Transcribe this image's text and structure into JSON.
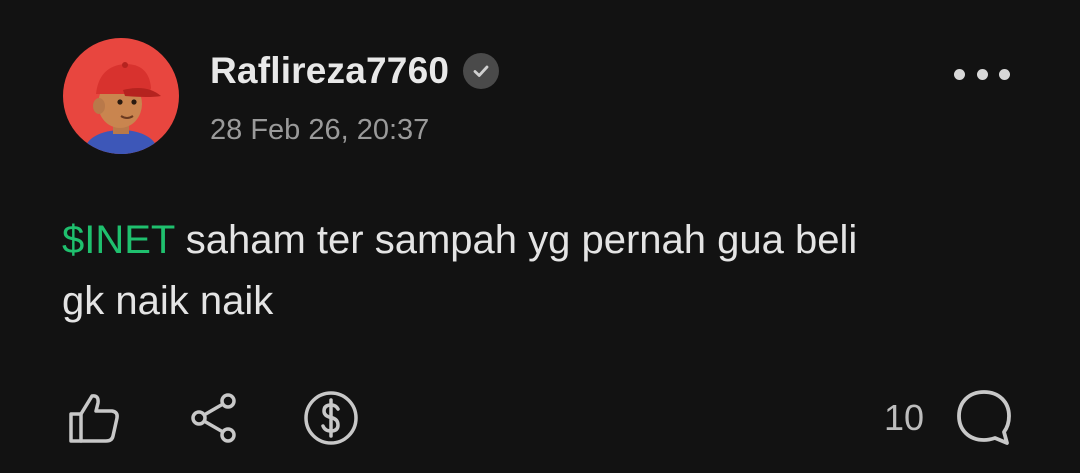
{
  "post": {
    "username": "Raflireza7760",
    "timestamp": "28 Feb 26, 20:37",
    "ticker": "$INET",
    "body_line1": " saham ter sampah yg pernah gua beli",
    "body_line2": "gk naik naik",
    "comment_count": "10"
  },
  "colors": {
    "background": "#121212",
    "ticker": "#1fc06e",
    "avatar_bg": "#e8463f",
    "icon": "#c8c8c8"
  },
  "icons": {
    "verified": "verified-check-icon",
    "more": "more-dots-icon",
    "like": "thumbs-up-icon",
    "share": "share-icon",
    "tip": "dollar-circle-icon",
    "comment": "comment-bubble-icon"
  }
}
